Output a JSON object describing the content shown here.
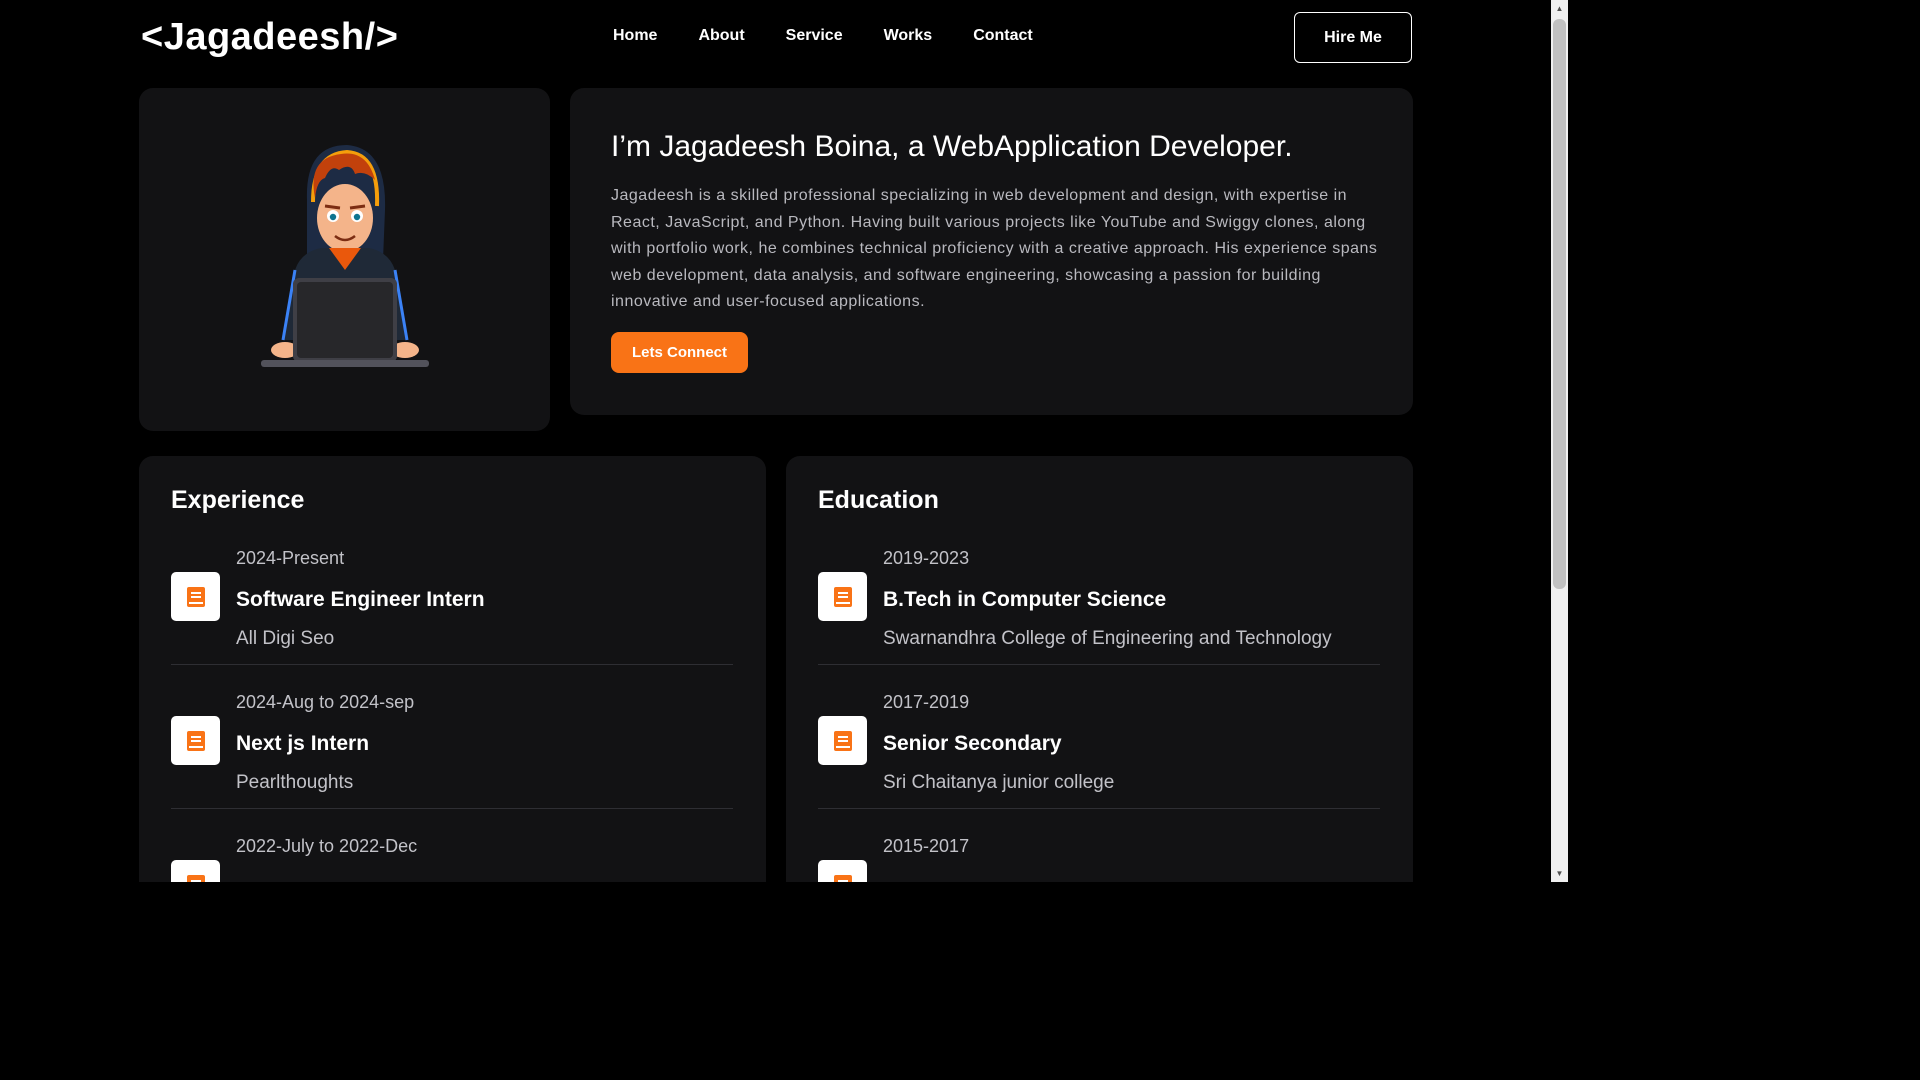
{
  "header": {
    "logo": "<Jagadeesh/>",
    "nav": [
      "Home",
      "About",
      "Service",
      "Works",
      "Contact"
    ],
    "hire_label": "Hire Me"
  },
  "intro": {
    "title": "I’m Jagadeesh Boina, a WebApplication Developer.",
    "description": "Jagadeesh is a skilled professional specializing in web development and design, with expertise in React, JavaScript, and Python. Having built various projects like YouTube and Swiggy clones, along with portfolio work, he combines technical proficiency with a creative approach. His experience spans web development, data analysis, and software engineering, showcasing a passion for building innovative and user-focused applications.",
    "cta_label": "Lets Connect"
  },
  "experience": {
    "title": "Experience",
    "items": [
      {
        "period": "2024-Present",
        "role": "Software Engineer Intern",
        "org": "All Digi Seo"
      },
      {
        "period": "2024-Aug to 2024-sep",
        "role": "Next js Intern",
        "org": "Pearlthoughts"
      },
      {
        "period": "2022-July to 2022-Dec",
        "role": "",
        "org": ""
      }
    ]
  },
  "education": {
    "title": "Education",
    "items": [
      {
        "period": "2019-2023",
        "role": "B.Tech in Computer Science",
        "org": "Swarnandhra College of Engineering and Technology"
      },
      {
        "period": "2017-2019",
        "role": "Senior Secondary",
        "org": "Sri Chaitanya junior college"
      },
      {
        "period": "2015-2017",
        "role": "",
        "org": ""
      }
    ]
  },
  "colors": {
    "accent": "#f97316",
    "card_bg": "#121214",
    "page_bg": "#000000"
  },
  "icons": {
    "timeline_icon": "book-icon",
    "avatar": "developer-avatar"
  }
}
